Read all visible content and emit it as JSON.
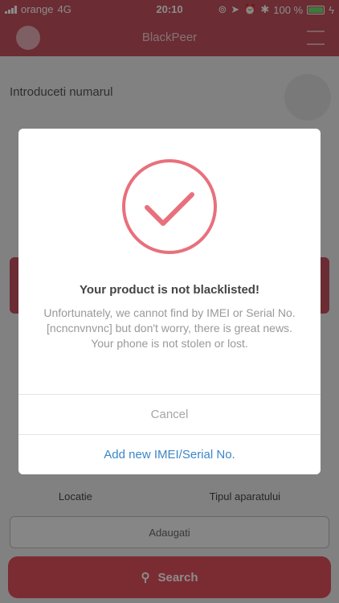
{
  "status_bar": {
    "carrier": "orange",
    "network": "4G",
    "time": "20:10",
    "battery": "100 %"
  },
  "background": {
    "header_title": "BlackPeer",
    "search_hint": "Introduceti numarul",
    "bottom_label_left": "Locatie",
    "bottom_label_right": "Tipul aparatului",
    "outlined_label": "Adaugati",
    "search_button": "Search"
  },
  "dialog": {
    "icon": "checkmark-circle-icon",
    "title": "Your product is not blacklisted!",
    "message": "Unfortunately, we cannot find by IMEI or Serial No. [ncncnvnvnc] but don't worry, there is great news. Your phone is not stolen or lost.",
    "cancel_label": "Cancel",
    "add_label": "Add new IMEI/Serial No."
  },
  "colors": {
    "accent": "#e8707c",
    "link": "#3a86c8",
    "header": "#c4505e"
  }
}
